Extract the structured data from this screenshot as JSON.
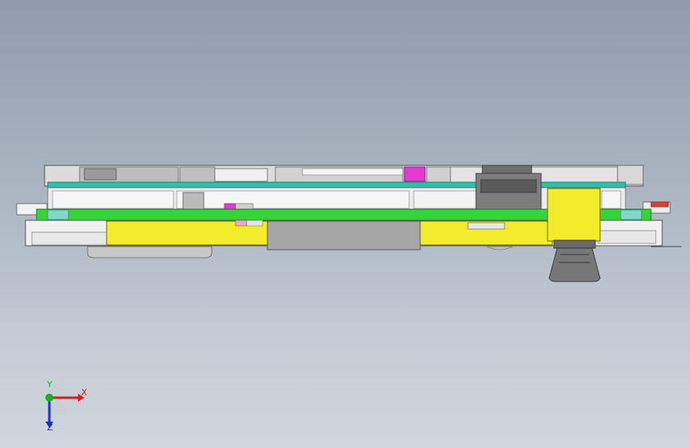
{
  "colors": {
    "background_top": "#8f9cac",
    "background_bottom": "#d0d6dd",
    "pcb_green": "#36d43a",
    "pcb_teal": "#2fbfaa",
    "battery_yellow": "#f2ec2a",
    "connector_magenta": "#e23dd2",
    "metal_gray": "#8e8e8e",
    "frame_light_gray": "#e6e6e6",
    "axis_x": "#e01b1b",
    "axis_y": "#17b319",
    "axis_z": "#1a2fd6"
  },
  "triad": {
    "x_label": "X",
    "y_label": "Y",
    "z_label": "Z"
  },
  "icons": {
    "triad": "coordinate-triad-icon"
  }
}
